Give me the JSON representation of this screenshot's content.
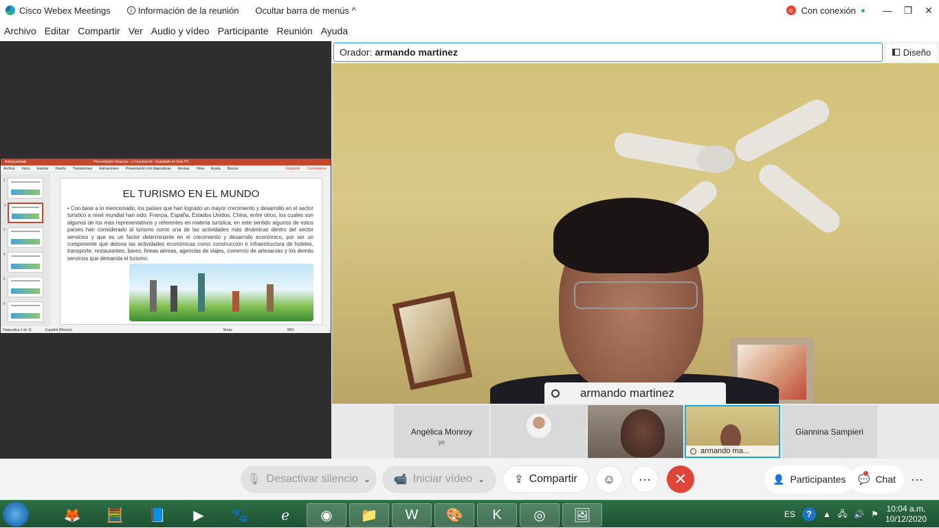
{
  "titlebar": {
    "app_name": "Cisco Webex Meetings",
    "info_label": "Información de la reunión",
    "hide_menu_label": "Ocultar barra de menús",
    "hide_menu_chevron": "^",
    "connection_status": "Con conexión",
    "minimize": "—",
    "restore": "❐",
    "close": "✕"
  },
  "menubar": {
    "items": [
      "Archivo",
      "Editar",
      "Compartir",
      "Ver",
      "Audio y vídeo",
      "Participante",
      "Reunión",
      "Ayuda"
    ]
  },
  "shared_content": {
    "ppt_title": "Presentación Veracruz - y Cozumel.ob  -  Guardado en Este PC",
    "ppt_autosave": "Autoguardado",
    "ppt_ribbon": [
      "Archivo",
      "Inicio",
      "Insertar",
      "Diseño",
      "Transiciones",
      "Animaciones",
      "Presentación con diapositivas",
      "Revisar",
      "Vista",
      "Ayuda",
      "Buscar"
    ],
    "ppt_share": "Compartir",
    "ppt_comments": "Comentarios",
    "slide_title": "EL TURISMO EN EL MUNDO",
    "slide_body": "• Con base a lo mencionado, los países que han logrado un mayor crecimiento y desarrollo en el sector turístico a nivel mundial han sido: Francia, España, Estados Unidos, China, entre otros, los cuales son algunos de los más representativos y referentes en materia turística; en este sentido algunos de estos países han considerado al turismo como una de las actividades más dinámicas dentro del sector servicios y que es un factor determinante en el crecimiento y desarrollo económico, por ser un componente que detona las actividades económicas como construcción e infraestructura de hoteles, transporte, restaurantes, bares, líneas aéreas, agencias de viajes, comercio de artesanías y los demás servicios que demanda el turismo.",
    "thumb_numbers": [
      "1",
      "2",
      "3",
      "4",
      "5",
      "6"
    ],
    "status_left": "Diapositiva 2 de 11",
    "status_lang": "Español (México)",
    "status_notes": "Notas",
    "status_zoom": "85%"
  },
  "speaker": {
    "prefix": "Orador:",
    "name": "armando martinez"
  },
  "layout_button": "Diseño",
  "main_video": {
    "name_label": "armando martinez"
  },
  "filmstrip": {
    "tile1_name": "Angélica Monroy",
    "tile1_sub": "yo",
    "tile4_label": "armando ma...",
    "tile5_name": "Giannina Sampieri"
  },
  "controls": {
    "mute_label": "Desactivar silencio",
    "video_label": "Iniciar vídeo",
    "share_label": "Compartir",
    "more_glyph": "···",
    "end_glyph": "✕",
    "caret": "⌄",
    "participants_label": "Participantes",
    "chat_label": "Chat"
  },
  "taskbar": {
    "language": "ES",
    "time": "10:04 a.m.",
    "date": "10/12/2020",
    "help": "?"
  },
  "colors": {
    "accent": "#1aa6d8",
    "end_call": "#e0453a",
    "ppt_brand": "#c4462c"
  }
}
